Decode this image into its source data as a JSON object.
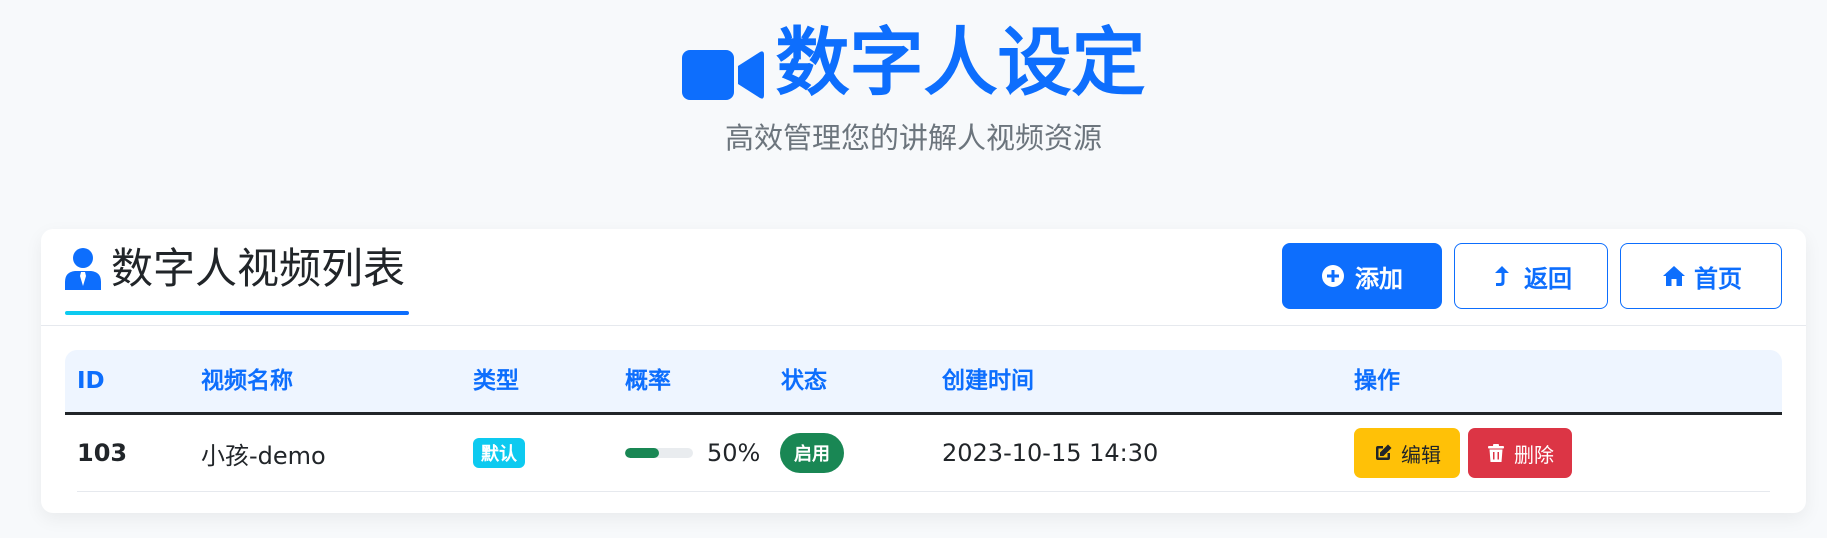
{
  "hero": {
    "title": "数字人设定",
    "subtitle": "高效管理您的讲解人视频资源",
    "icon": "video-camera-icon"
  },
  "panel": {
    "title": "数字人视频列表",
    "icon": "user-tie-icon",
    "buttons": {
      "add": "添加",
      "back": "返回",
      "home": "首页"
    }
  },
  "table": {
    "headers": {
      "id": "ID",
      "name": "视频名称",
      "type": "类型",
      "probability": "概率",
      "status": "状态",
      "created": "创建时间",
      "actions": "操作"
    },
    "rows": [
      {
        "id": "103",
        "name": "小孩-demo",
        "type": "默认",
        "probability_label": "50%",
        "probability_value": 0.5,
        "status": "启用",
        "created": "2023-10-15 14:30",
        "edit_label": "编辑",
        "delete_label": "删除"
      }
    ]
  },
  "colors": {
    "primary": "#0d6efd",
    "info": "#0dcaf0",
    "success": "#198754",
    "warning": "#ffc107",
    "danger": "#dc3545",
    "muted": "#6c757d"
  }
}
